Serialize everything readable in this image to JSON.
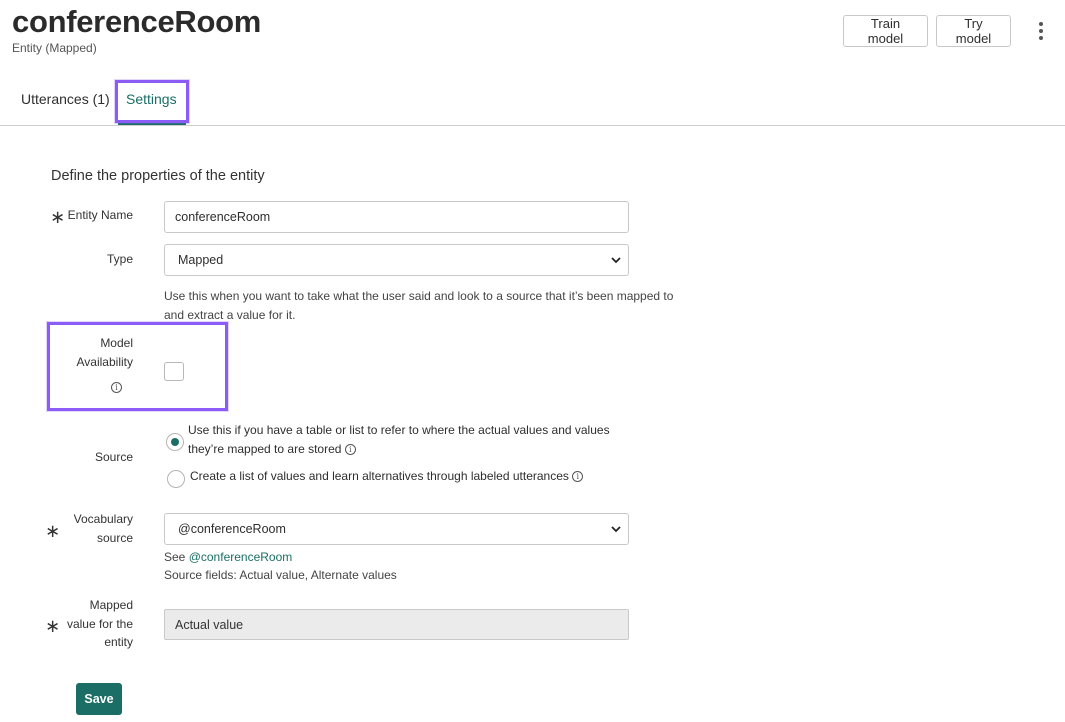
{
  "header": {
    "title": "conferenceRoom",
    "subtitle": "Entity (Mapped)",
    "train_label": "Train model",
    "try_label": "Try model"
  },
  "tabs": [
    {
      "label": "Utterances (1)",
      "active": false
    },
    {
      "label": "Settings",
      "active": true
    }
  ],
  "form": {
    "heading": "Define the properties of the entity",
    "entity_name": {
      "label": "Entity Name",
      "value": "conferenceRoom",
      "required": true
    },
    "type": {
      "label": "Type",
      "value": "Mapped",
      "help": "Use this when you want to take what the user said and look to a source that it’s been mapped to and extract a value for it."
    },
    "model_availability": {
      "label_line1": "Model",
      "label_line2": "Availability",
      "checked": false
    },
    "source": {
      "label": "Source",
      "options": [
        {
          "text_line1": "Use this if you have a table or list to refer to where the actual values and values",
          "text_line2": "they’re mapped to are stored",
          "checked": true
        },
        {
          "text_line1": "Create a list of values and learn alternatives through labeled utterances",
          "checked": false
        }
      ]
    },
    "vocabulary_source": {
      "label_line1": "Vocabulary",
      "label_line2": "source",
      "value": "@conferenceRoom",
      "see_prefix": "See",
      "see_link": "@conferenceRoom",
      "source_fields": "Source fields: Actual value, Alternate values",
      "required": true
    },
    "mapped_value": {
      "label_line1": "Mapped",
      "label_line2": "value for the",
      "label_line3": "entity",
      "value": "Actual value",
      "required": true
    },
    "save_label": "Save"
  },
  "colors": {
    "accent": "#1a6e66",
    "highlight": "#8b5cf6"
  }
}
